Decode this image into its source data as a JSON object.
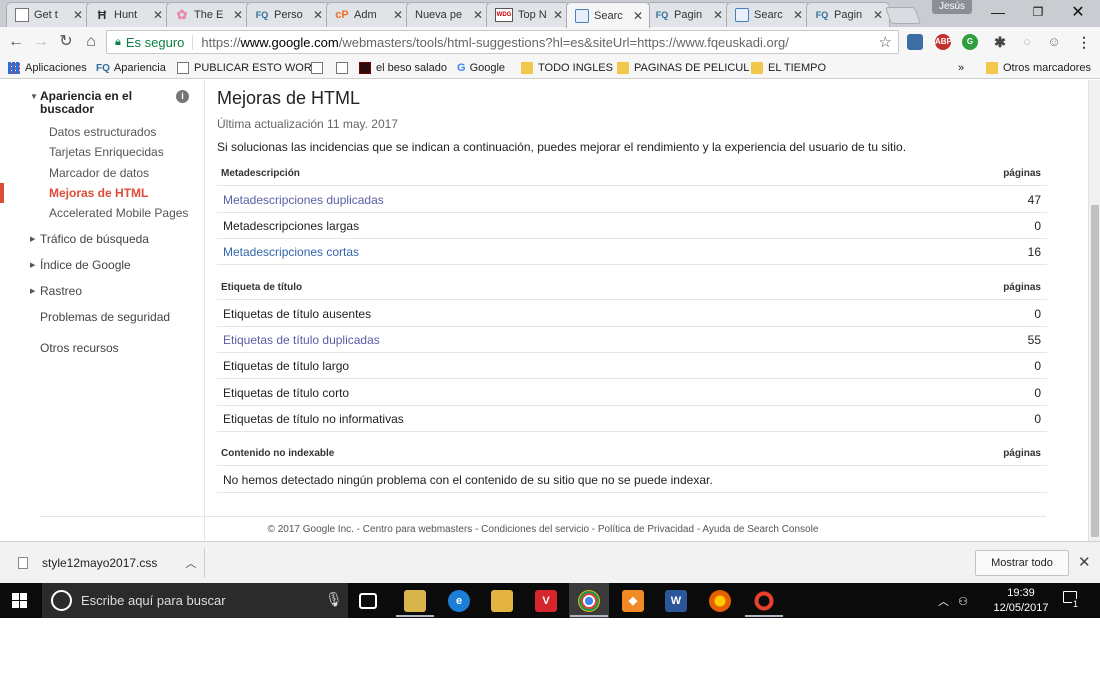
{
  "tabs": [
    {
      "title": "Get t",
      "icon": "page-icon"
    },
    {
      "title": "Hunt",
      "icon": "hunt-icon"
    },
    {
      "title": "The E",
      "icon": "flower-icon"
    },
    {
      "title": "Perso",
      "icon": "fq-icon"
    },
    {
      "title": "Adm",
      "icon": "cpanel-icon"
    },
    {
      "title": "Nueva pe",
      "icon": "none"
    },
    {
      "title": "Top N",
      "icon": "wdg-icon"
    },
    {
      "title": "Searc",
      "icon": "search-console-icon"
    },
    {
      "title": "Pagin",
      "icon": "fq-icon"
    },
    {
      "title": "Searc",
      "icon": "search-console-icon"
    },
    {
      "title": "Pagin",
      "icon": "fq-icon"
    }
  ],
  "active_tab_index": 7,
  "user_badge": "Jesús",
  "address": {
    "secure_label": "Es seguro",
    "url_scheme": "https://",
    "url_host": "www.google.com",
    "url_path": "/webmasters/tools/html-suggestions?hl=es&siteUrl=https://www.fqeuskadi.org/"
  },
  "bookmarks": {
    "items": [
      {
        "label": "Aplicaciones",
        "icon": "apps-grid-icon"
      },
      {
        "label": "Apariencia",
        "icon": "fq-icon"
      },
      {
        "label": "PUBLICAR ESTO WOR",
        "icon": "page-icon"
      },
      {
        "label": "",
        "icon": "page-icon"
      },
      {
        "label": "",
        "icon": "page-icon"
      },
      {
        "label": "el beso salado",
        "icon": "image-icon"
      },
      {
        "label": "Google",
        "icon": "google-icon"
      },
      {
        "label": "TODO INGLES",
        "icon": "folder-icon"
      },
      {
        "label": "PAGINAS DE PELICUL",
        "icon": "folder-icon"
      },
      {
        "label": "EL TIEMPO",
        "icon": "folder-icon"
      }
    ],
    "overflow": "»",
    "other": "Otros marcadores"
  },
  "sidebar": {
    "section": "Apariencia en el buscador",
    "subitems": [
      "Datos estructurados",
      "Tarjetas Enriquecidas",
      "Marcador de datos",
      "Mejoras de HTML",
      "Accelerated Mobile Pages"
    ],
    "active": "Mejoras de HTML",
    "collapsed": [
      "Tráfico de búsqueda",
      "Índice de Google",
      "Rastreo"
    ],
    "plain": [
      "Problemas de seguridad",
      "Otros recursos"
    ]
  },
  "main": {
    "title": "Mejoras de HTML",
    "last_update": "Última actualización 11 may. 2017",
    "intro": "Si solucionas las incidencias que se indican a continuación, puedes mejorar el rendimiento y la experiencia del usuario de tu sitio.",
    "sections": [
      {
        "header": "Metadescripción",
        "count_header": "páginas",
        "rows": [
          {
            "label": "Metadescripciones duplicadas",
            "count": "47",
            "link": true
          },
          {
            "label": "Metadescripciones largas",
            "count": "0",
            "link": false
          },
          {
            "label": "Metadescripciones cortas",
            "count": "16",
            "link": true
          }
        ]
      },
      {
        "header": "Etiqueta de título",
        "count_header": "páginas",
        "rows": [
          {
            "label": "Etiquetas de título ausentes",
            "count": "0",
            "link": false
          },
          {
            "label": "Etiquetas de título duplicadas",
            "count": "55",
            "link": true
          },
          {
            "label": "Etiquetas de título largo",
            "count": "0",
            "link": false
          },
          {
            "label": "Etiquetas de título corto",
            "count": "0",
            "link": false
          },
          {
            "label": "Etiquetas de título no informativas",
            "count": "0",
            "link": false
          }
        ]
      },
      {
        "header": "Contenido no indexable",
        "count_header": "páginas",
        "message": "No hemos detectado ningún problema con el contenido de su sitio que no se puede indexar."
      }
    ]
  },
  "footer": "© 2017 Google Inc. - Centro para webmasters - Condiciones del servicio - Política de Privacidad - Ayuda de Search Console",
  "download_bar": {
    "filename": "style12mayo2017.css",
    "show_all": "Mostrar todo"
  },
  "taskbar": {
    "search_placeholder": "Escribe aquí para buscar",
    "time": "19:39",
    "date": "12/05/2017",
    "notifications": "1"
  },
  "colors": {
    "accent_red": "#dd4b39",
    "link_purple": "#5b5ea6",
    "link_blue": "#3366aa",
    "secure_green": "#0b8043"
  }
}
